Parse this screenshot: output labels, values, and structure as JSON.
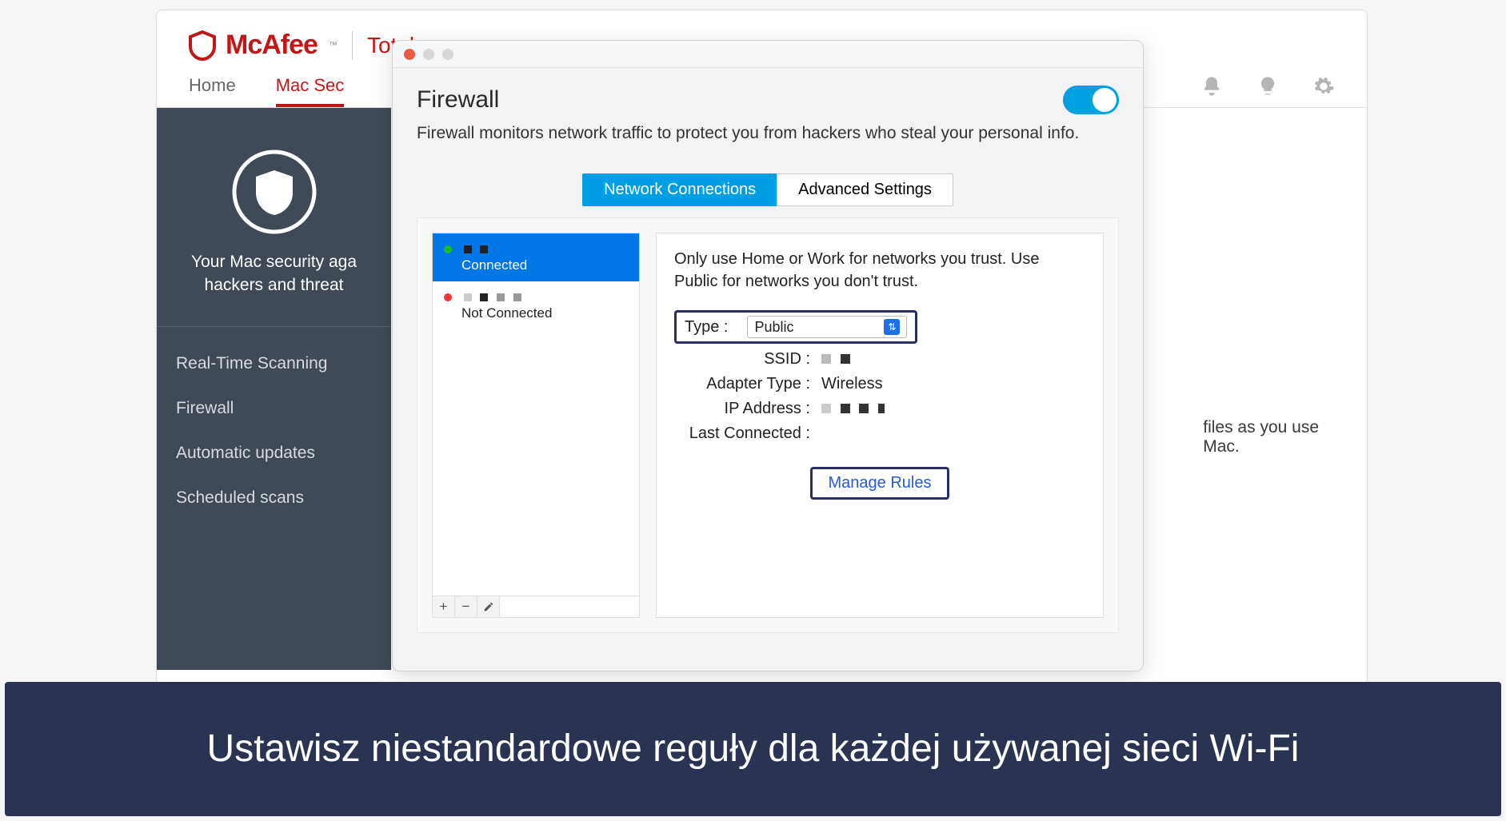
{
  "mcafee": {
    "brand": "McAfee",
    "product": "Total",
    "tabs": {
      "home": "Home",
      "mac_security": "Mac Sec"
    },
    "sidebar": {
      "heading_line1": "Your Mac security aga",
      "heading_line2": "hackers and threat",
      "items": [
        "Real-Time Scanning",
        "Firewall",
        "Automatic updates",
        "Scheduled scans"
      ]
    },
    "right_fragment_line1": "files as you use",
    "right_fragment_line2": "Mac."
  },
  "firewall": {
    "title": "Firewall",
    "description": "Firewall monitors network traffic to protect you from hackers who steal your personal info.",
    "tabs": {
      "connections": "Network Connections",
      "advanced": "Advanced Settings"
    },
    "list": {
      "item1_status": "Connected",
      "item2_status": "Not Connected"
    },
    "hint": "Only use Home or Work for networks you trust. Use Public for networks you don't trust.",
    "labels": {
      "type": "Type :",
      "ssid": "SSID :",
      "adapter": "Adapter Type :",
      "ip": "IP Address :",
      "last": "Last Connected :"
    },
    "values": {
      "type_selected": "Public",
      "adapter": "Wireless"
    },
    "manage_rules": "Manage Rules"
  },
  "caption": "Ustawisz niestandardowe reguły dla każdej używanej sieci Wi-Fi"
}
